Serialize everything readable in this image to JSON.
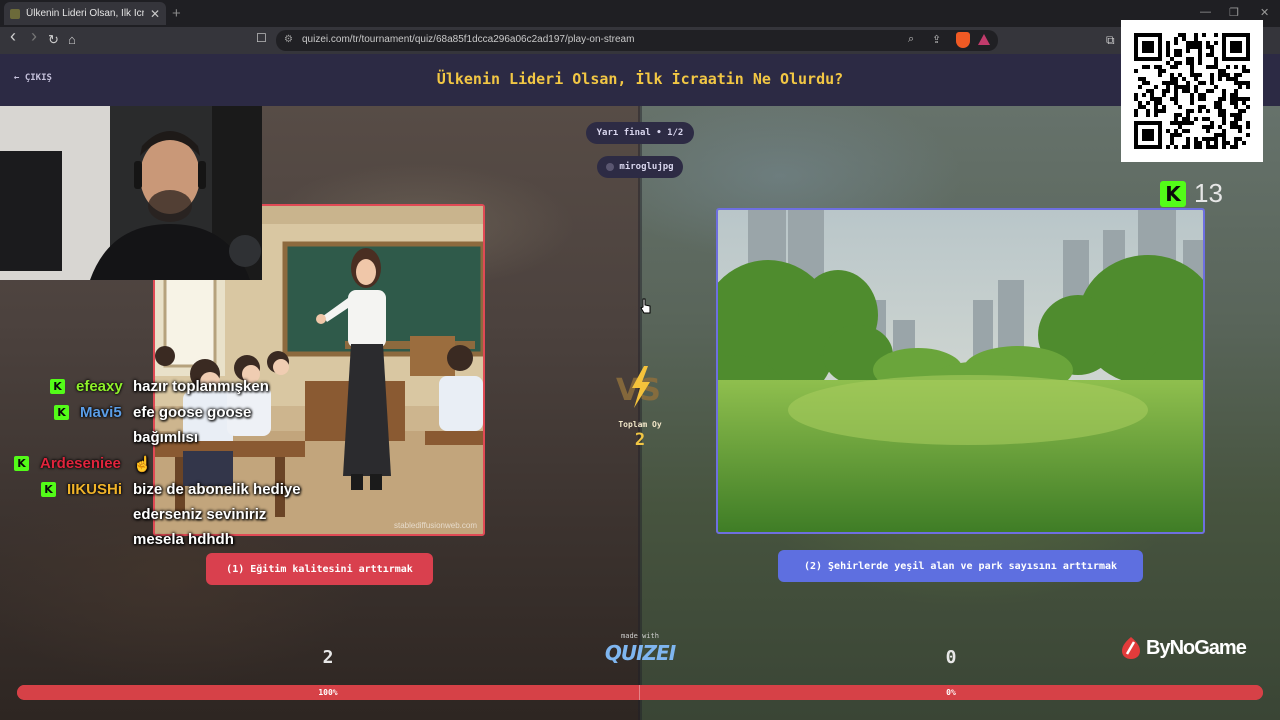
{
  "browser": {
    "tab_title": "Ülkenin Lideri Olsan, İlk İcraatin",
    "tab_close": "✕",
    "new_tab": "+",
    "url": "quizei.com/tr/tournament/quiz/68a85f1dcca296a06c2ad197/play-on-stream",
    "window_controls": [
      "—",
      "❐",
      "✕"
    ],
    "nav": {
      "back": "‹",
      "forward": "›",
      "reload": "↻",
      "home": "⌂"
    }
  },
  "page": {
    "back_label": "← ÇIKIŞ",
    "quiz_title": "Ülkenin Lideri Olsan, İlk İcraatin Ne Olurdu?",
    "round_label": "Yarı final • 1/2",
    "host_name": "miroglujpg",
    "total_votes_label": "Toplam Oy",
    "total_votes": "2",
    "made_with": "made with",
    "brand": "QUIZEI",
    "options": [
      {
        "label": "(1) Eğitim kalitesini arttırmak",
        "image": "classroom with teacher and students",
        "watermark": "stablediffusionweb.com",
        "votes": "2",
        "percent_label": "100%",
        "percent": 100,
        "color": "#d9404e"
      },
      {
        "label": "(2) Şehirlerde yeşil alan ve park sayısını arttırmak",
        "image": "green park with city skyscrapers",
        "votes": "0",
        "percent_label": "0%",
        "percent": 0,
        "color": "#5e6fe0"
      }
    ]
  },
  "overlay": {
    "kick_viewers": "13",
    "kick_letter": "K",
    "sponsor": "ByNoGame",
    "chat": [
      {
        "user": "efeaxy",
        "color": "#8ef02a",
        "lines": [
          "hazır toplanmışken"
        ]
      },
      {
        "user": "Mavi5",
        "color": "#5b9ee8",
        "lines": [
          "efe goose goose",
          "bağımlısı"
        ]
      },
      {
        "user": "Ardeseniee",
        "color": "#e0243c",
        "lines": [
          "☝"
        ]
      },
      {
        "user": "IIKUSHi",
        "color": "#f0b329",
        "lines": [
          "bize de abonelik hediye",
          "ederseniz seviniriz",
          "mesela hdhdh"
        ]
      }
    ]
  },
  "colors": {
    "header_bg": "#2c2a44",
    "title_yellow": "#f2c744",
    "kick_green": "#53fc18",
    "progress_red": "#d64147"
  }
}
